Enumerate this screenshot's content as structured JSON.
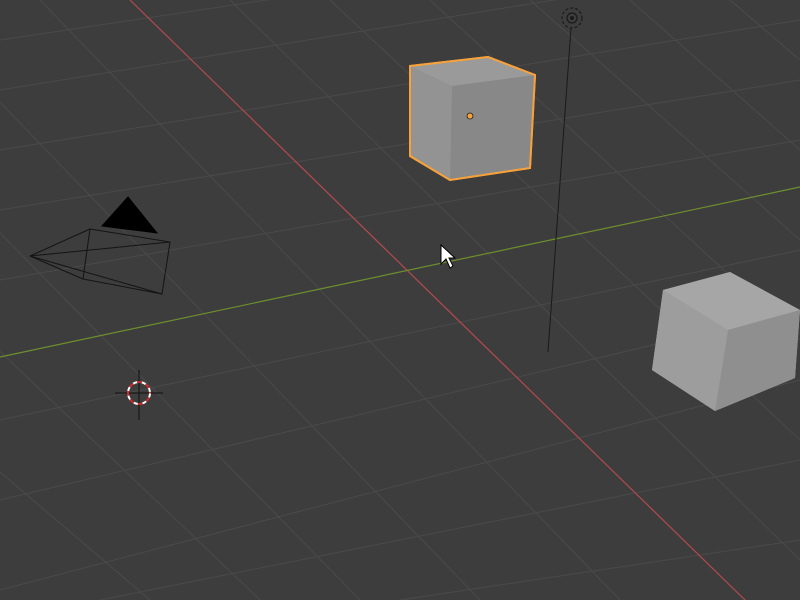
{
  "viewport": {
    "background": "#3d3d3d",
    "grid_color": "#4a4a4a",
    "x_axis_color": "#b34a4f",
    "y_axis_color": "#6e8f2e"
  },
  "objects": [
    {
      "type": "cube",
      "selected": true,
      "outline_color": "#f7a13b",
      "origin_color": "#f7a13b",
      "icon": "cube-icon"
    },
    {
      "type": "cube",
      "selected": false,
      "icon": "cube-icon"
    },
    {
      "type": "camera",
      "selected": false,
      "icon": "camera-icon"
    },
    {
      "type": "light",
      "selected": false,
      "icon": "light-icon"
    },
    {
      "type": "3d-cursor",
      "icon": "crosshair-icon"
    }
  ],
  "mouse_cursor": {
    "icon": "mouse-pointer-icon"
  }
}
